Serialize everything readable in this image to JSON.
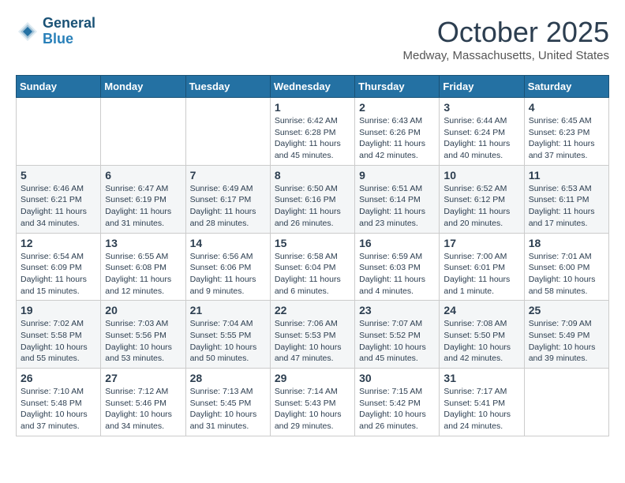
{
  "header": {
    "logo_line1": "General",
    "logo_line2": "Blue",
    "month": "October 2025",
    "location": "Medway, Massachusetts, United States"
  },
  "days_of_week": [
    "Sunday",
    "Monday",
    "Tuesday",
    "Wednesday",
    "Thursday",
    "Friday",
    "Saturday"
  ],
  "weeks": [
    [
      {
        "day": "",
        "sunrise": "",
        "sunset": "",
        "daylight": ""
      },
      {
        "day": "",
        "sunrise": "",
        "sunset": "",
        "daylight": ""
      },
      {
        "day": "",
        "sunrise": "",
        "sunset": "",
        "daylight": ""
      },
      {
        "day": "1",
        "sunrise": "Sunrise: 6:42 AM",
        "sunset": "Sunset: 6:28 PM",
        "daylight": "Daylight: 11 hours and 45 minutes."
      },
      {
        "day": "2",
        "sunrise": "Sunrise: 6:43 AM",
        "sunset": "Sunset: 6:26 PM",
        "daylight": "Daylight: 11 hours and 42 minutes."
      },
      {
        "day": "3",
        "sunrise": "Sunrise: 6:44 AM",
        "sunset": "Sunset: 6:24 PM",
        "daylight": "Daylight: 11 hours and 40 minutes."
      },
      {
        "day": "4",
        "sunrise": "Sunrise: 6:45 AM",
        "sunset": "Sunset: 6:23 PM",
        "daylight": "Daylight: 11 hours and 37 minutes."
      }
    ],
    [
      {
        "day": "5",
        "sunrise": "Sunrise: 6:46 AM",
        "sunset": "Sunset: 6:21 PM",
        "daylight": "Daylight: 11 hours and 34 minutes."
      },
      {
        "day": "6",
        "sunrise": "Sunrise: 6:47 AM",
        "sunset": "Sunset: 6:19 PM",
        "daylight": "Daylight: 11 hours and 31 minutes."
      },
      {
        "day": "7",
        "sunrise": "Sunrise: 6:49 AM",
        "sunset": "Sunset: 6:17 PM",
        "daylight": "Daylight: 11 hours and 28 minutes."
      },
      {
        "day": "8",
        "sunrise": "Sunrise: 6:50 AM",
        "sunset": "Sunset: 6:16 PM",
        "daylight": "Daylight: 11 hours and 26 minutes."
      },
      {
        "day": "9",
        "sunrise": "Sunrise: 6:51 AM",
        "sunset": "Sunset: 6:14 PM",
        "daylight": "Daylight: 11 hours and 23 minutes."
      },
      {
        "day": "10",
        "sunrise": "Sunrise: 6:52 AM",
        "sunset": "Sunset: 6:12 PM",
        "daylight": "Daylight: 11 hours and 20 minutes."
      },
      {
        "day": "11",
        "sunrise": "Sunrise: 6:53 AM",
        "sunset": "Sunset: 6:11 PM",
        "daylight": "Daylight: 11 hours and 17 minutes."
      }
    ],
    [
      {
        "day": "12",
        "sunrise": "Sunrise: 6:54 AM",
        "sunset": "Sunset: 6:09 PM",
        "daylight": "Daylight: 11 hours and 15 minutes."
      },
      {
        "day": "13",
        "sunrise": "Sunrise: 6:55 AM",
        "sunset": "Sunset: 6:08 PM",
        "daylight": "Daylight: 11 hours and 12 minutes."
      },
      {
        "day": "14",
        "sunrise": "Sunrise: 6:56 AM",
        "sunset": "Sunset: 6:06 PM",
        "daylight": "Daylight: 11 hours and 9 minutes."
      },
      {
        "day": "15",
        "sunrise": "Sunrise: 6:58 AM",
        "sunset": "Sunset: 6:04 PM",
        "daylight": "Daylight: 11 hours and 6 minutes."
      },
      {
        "day": "16",
        "sunrise": "Sunrise: 6:59 AM",
        "sunset": "Sunset: 6:03 PM",
        "daylight": "Daylight: 11 hours and 4 minutes."
      },
      {
        "day": "17",
        "sunrise": "Sunrise: 7:00 AM",
        "sunset": "Sunset: 6:01 PM",
        "daylight": "Daylight: 11 hours and 1 minute."
      },
      {
        "day": "18",
        "sunrise": "Sunrise: 7:01 AM",
        "sunset": "Sunset: 6:00 PM",
        "daylight": "Daylight: 10 hours and 58 minutes."
      }
    ],
    [
      {
        "day": "19",
        "sunrise": "Sunrise: 7:02 AM",
        "sunset": "Sunset: 5:58 PM",
        "daylight": "Daylight: 10 hours and 55 minutes."
      },
      {
        "day": "20",
        "sunrise": "Sunrise: 7:03 AM",
        "sunset": "Sunset: 5:56 PM",
        "daylight": "Daylight: 10 hours and 53 minutes."
      },
      {
        "day": "21",
        "sunrise": "Sunrise: 7:04 AM",
        "sunset": "Sunset: 5:55 PM",
        "daylight": "Daylight: 10 hours and 50 minutes."
      },
      {
        "day": "22",
        "sunrise": "Sunrise: 7:06 AM",
        "sunset": "Sunset: 5:53 PM",
        "daylight": "Daylight: 10 hours and 47 minutes."
      },
      {
        "day": "23",
        "sunrise": "Sunrise: 7:07 AM",
        "sunset": "Sunset: 5:52 PM",
        "daylight": "Daylight: 10 hours and 45 minutes."
      },
      {
        "day": "24",
        "sunrise": "Sunrise: 7:08 AM",
        "sunset": "Sunset: 5:50 PM",
        "daylight": "Daylight: 10 hours and 42 minutes."
      },
      {
        "day": "25",
        "sunrise": "Sunrise: 7:09 AM",
        "sunset": "Sunset: 5:49 PM",
        "daylight": "Daylight: 10 hours and 39 minutes."
      }
    ],
    [
      {
        "day": "26",
        "sunrise": "Sunrise: 7:10 AM",
        "sunset": "Sunset: 5:48 PM",
        "daylight": "Daylight: 10 hours and 37 minutes."
      },
      {
        "day": "27",
        "sunrise": "Sunrise: 7:12 AM",
        "sunset": "Sunset: 5:46 PM",
        "daylight": "Daylight: 10 hours and 34 minutes."
      },
      {
        "day": "28",
        "sunrise": "Sunrise: 7:13 AM",
        "sunset": "Sunset: 5:45 PM",
        "daylight": "Daylight: 10 hours and 31 minutes."
      },
      {
        "day": "29",
        "sunrise": "Sunrise: 7:14 AM",
        "sunset": "Sunset: 5:43 PM",
        "daylight": "Daylight: 10 hours and 29 minutes."
      },
      {
        "day": "30",
        "sunrise": "Sunrise: 7:15 AM",
        "sunset": "Sunset: 5:42 PM",
        "daylight": "Daylight: 10 hours and 26 minutes."
      },
      {
        "day": "31",
        "sunrise": "Sunrise: 7:17 AM",
        "sunset": "Sunset: 5:41 PM",
        "daylight": "Daylight: 10 hours and 24 minutes."
      },
      {
        "day": "",
        "sunrise": "",
        "sunset": "",
        "daylight": ""
      }
    ]
  ]
}
